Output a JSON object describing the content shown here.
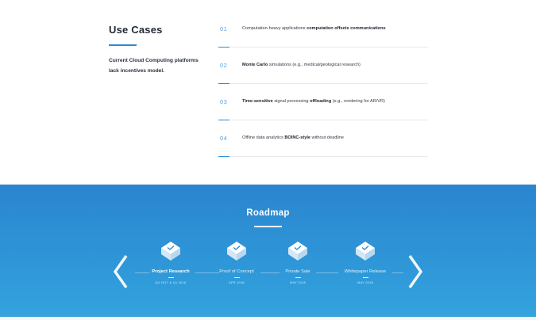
{
  "use_cases": {
    "title": "Use Cases",
    "description": "Current Cloud Computing platforms lack incentives model.",
    "items": [
      {
        "num": "01",
        "pre": "Computation-heavy applications ",
        "bold": "computation offsets communications",
        "post": ""
      },
      {
        "num": "02",
        "pre": "",
        "bold": "Monte Carlo",
        "post": " simulations (e.g., medical/geological research)"
      },
      {
        "num": "03",
        "pre": "",
        "bold": "Time-sensitive",
        "post": " signal processing ",
        "bold2": "offloading",
        "post2": " (e.g., rendering for AR/VR)"
      },
      {
        "num": "04",
        "pre": "Offline data analytics ",
        "bold": "BOINC-style",
        "post": " without deadline"
      }
    ]
  },
  "roadmap": {
    "title": "Roadmap",
    "milestones": [
      {
        "label": "Project Research",
        "date": "Q4 2017 & Q1 2018"
      },
      {
        "label": "Proof of Concept",
        "date": "APR 2018"
      },
      {
        "label": "Private Sale",
        "date": "MAY 2018"
      },
      {
        "label": "Whitepaper Release",
        "date": "MAY 2018"
      }
    ]
  },
  "colors": {
    "accent": "#2d8bd6",
    "roadmap_bg_top": "#2a85cf",
    "roadmap_bg_bottom": "#34a4de"
  },
  "icons": {
    "milestone": "diamond-check-icon",
    "prev": "chevron-left-icon",
    "next": "chevron-right-icon"
  }
}
